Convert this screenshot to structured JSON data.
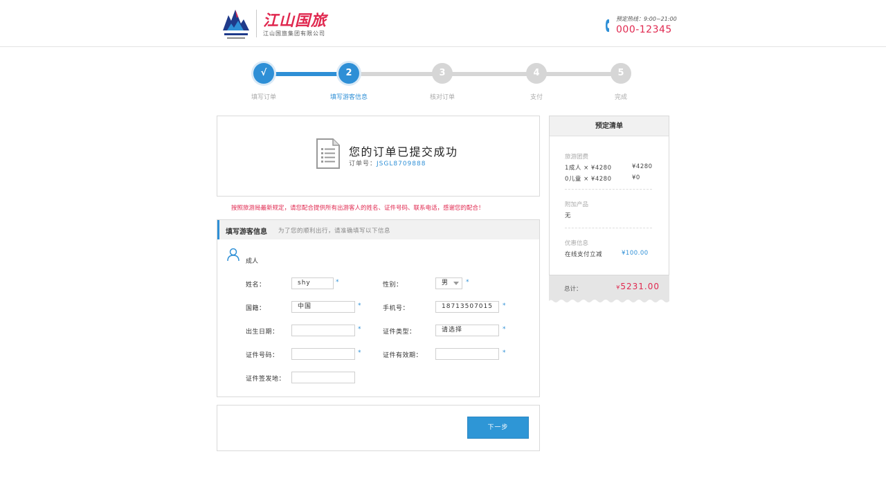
{
  "header": {
    "logo_cn": "江山国旅",
    "logo_sub": "江山国旅集团有限公司",
    "hotline_label": "预定热线：9:00~21:00",
    "hotline_number": "000-12345"
  },
  "steps": [
    {
      "number": "√",
      "label": "填写订单",
      "state": "done"
    },
    {
      "number": "2",
      "label": "填写游客信息",
      "state": "current"
    },
    {
      "number": "3",
      "label": "核对订单",
      "state": "pending"
    },
    {
      "number": "4",
      "label": "支付",
      "state": "pending"
    },
    {
      "number": "5",
      "label": "完成",
      "state": "pending"
    }
  ],
  "success": {
    "title": "您的订单已提交成功",
    "order_label": "订单号：",
    "order_number": "JSGL8709888"
  },
  "notice": "按照旅游局最新规定，请您配合提供所有出游客人的姓名、证件号码、联系电话，感谢您的配合！",
  "form": {
    "title": "填写游客信息",
    "subtitle": "为了您的顺利出行，请准确填写以下信息",
    "traveler_type": "成人",
    "required_mark": "*",
    "fields": {
      "name": {
        "label": "姓名：",
        "value": "shy"
      },
      "gender": {
        "label": "性别：",
        "value": "男"
      },
      "nationality": {
        "label": "国籍：",
        "value": "中国"
      },
      "phone": {
        "label": "手机号：",
        "value": "18713507015"
      },
      "birthdate": {
        "label": "出生日期：",
        "value": ""
      },
      "id_type": {
        "label": "证件类型：",
        "value": "请选择"
      },
      "id_number": {
        "label": "证件号码：",
        "value": ""
      },
      "id_expiry": {
        "label": "证件有效期：",
        "value": ""
      },
      "id_issue_place": {
        "label": "证件签发地：",
        "value": ""
      }
    }
  },
  "next_button": "下一步",
  "summary": {
    "title": "预定清单",
    "fee_label": "旅游团费",
    "adult_line": "1成人 × ¥4280",
    "adult_total": "¥4280",
    "child_line": "0儿童 × ¥4280",
    "child_total": "¥0",
    "addon_label": "附加产品",
    "addon_value": "无",
    "discount_label": "优惠信息",
    "discount_text": "在线支付立减",
    "discount_value": "¥100.00",
    "total_label": "总计：",
    "total_currency": "¥",
    "total_value": "5231.00"
  },
  "colors": {
    "accent": "#2e8fd6",
    "brand_red": "#e0284f",
    "inactive": "#d6d6d6"
  }
}
